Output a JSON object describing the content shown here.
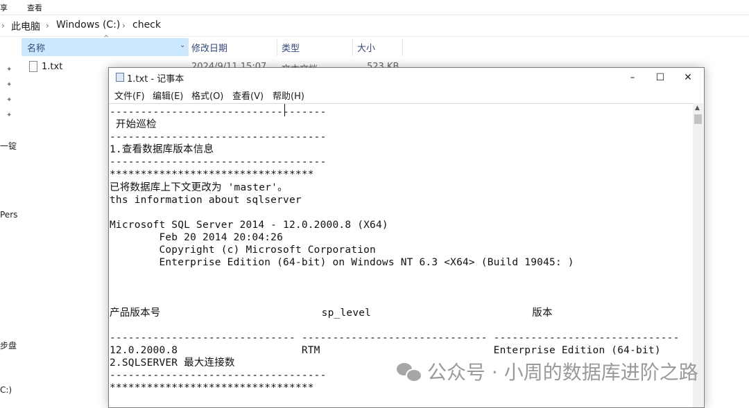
{
  "explorer": {
    "ribbon_tabs": [
      "享",
      "查看"
    ],
    "breadcrumb": [
      "此电脑",
      "Windows (C:)",
      "check"
    ],
    "nav_labels": [
      "一锭",
      "Pers",
      "步盘",
      "C:)"
    ],
    "columns": [
      "名称",
      "修改日期",
      "类型",
      "大小"
    ],
    "file": {
      "name": "1.txt",
      "date": "2024/9/11 15:07",
      "type": "文本文档",
      "size": "523 KB"
    }
  },
  "notepad": {
    "title": "1.txt - 记事本",
    "controls": {
      "minimize": "–",
      "maximize": "☐",
      "close": "✕"
    },
    "menu": [
      "文件(F)",
      "编辑(E)",
      "格式(O)",
      "查看(V)",
      "帮助(H)"
    ],
    "content": "-----------------------------------\n 开始巡检\n-----------------------------------\n1.查看数据库版本信息\n-----------------------------------\n*********************************\n已将数据库上下文更改为 'master'。\nths information about sqlserver\n\nMicrosoft SQL Server 2014 - 12.0.2000.8 (X64)\n        Feb 20 2014 20:04:26\n        Copyright (c) Microsoft Corporation\n        Enterprise Edition (64-bit) on Windows NT 6.3 <X64> (Build 19045: )\n\n\n\n产品版本号                          sp_level                          版本\n\n------------------------------ ------------------------------ ------------------------------\n12.0.2000.8                    RTM                            Enterprise Edition (64-bit)\n2.SQLSERVER 最大连接数\n-----------------------------------\n*********************************"
  },
  "watermark": "公众号 · 小周的数据库进阶之路"
}
